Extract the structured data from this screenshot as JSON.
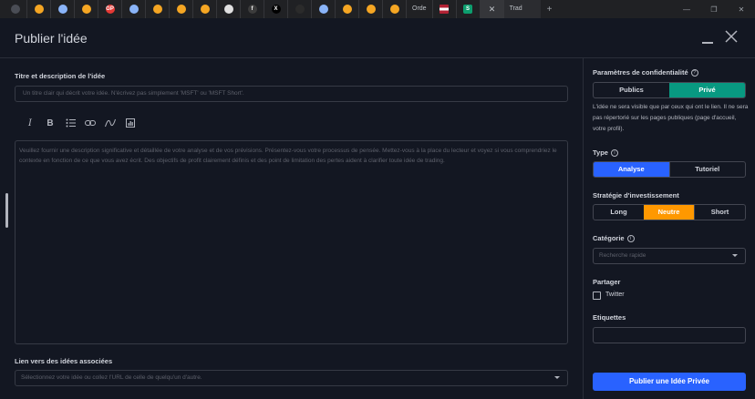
{
  "browser": {
    "tabs": [
      {
        "icon": "document-favicon-icon",
        "color": "#4a4d55",
        "glyph": ""
      },
      {
        "icon": "orange-favicon-icon",
        "color": "#f5a623",
        "glyph": ""
      },
      {
        "icon": "globe-favicon-icon",
        "color": "#8ab4f8",
        "glyph": ""
      },
      {
        "icon": "orange-favicon-icon",
        "color": "#f5a623",
        "glyph": ""
      },
      {
        "icon": "red-favicon-icon",
        "color": "#e53935",
        "glyph": "GP"
      },
      {
        "icon": "globe-favicon-icon",
        "color": "#8ab4f8",
        "glyph": ""
      },
      {
        "icon": "orange-favicon-icon",
        "color": "#f5a623",
        "glyph": ""
      },
      {
        "icon": "orange-favicon-icon",
        "color": "#f5a623",
        "glyph": ""
      },
      {
        "icon": "orange-favicon-icon",
        "color": "#f5a623",
        "glyph": ""
      },
      {
        "icon": "square-favicon-icon",
        "color": "#e0e0e0",
        "glyph": ""
      },
      {
        "icon": "dark-favicon-icon",
        "color": "#3c3c3c",
        "glyph": "f"
      },
      {
        "icon": "x-favicon-icon",
        "color": "#000000",
        "glyph": "X"
      },
      {
        "icon": "dark-favicon-icon",
        "color": "#2b2b2b",
        "glyph": ""
      },
      {
        "icon": "globe-favicon-icon",
        "color": "#8ab4f8",
        "glyph": ""
      },
      {
        "icon": "orange-favicon-icon",
        "color": "#f5a623",
        "glyph": ""
      },
      {
        "icon": "orange-favicon-icon",
        "color": "#f5a623",
        "glyph": ""
      },
      {
        "icon": "orange-favicon-icon",
        "color": "#f5a623",
        "glyph": ""
      }
    ],
    "text_tab": "Orde",
    "flag_icon": "us-flag-favicon-icon",
    "green_tab_glyph": "S",
    "active_tab_title": "Trad"
  },
  "dialog": {
    "title": "Publier l'idée"
  },
  "left": {
    "title_label": "Titre et description de l'idée",
    "title_placeholder": "Un titre clair qui décrit votre idée. N'écrivez pas simplement 'MSFT' ou 'MSFT Short'.",
    "toolbar": [
      "italic-icon",
      "bold-icon",
      "list-icon",
      "link-icon",
      "chart-icon",
      "image-icon"
    ],
    "description_placeholder": "Veuillez fournir une description significative et détaillée de votre analyse et de vos prévisions. Présentez-vous votre processus de pensée. Mettez-vous à la place du lecteur et voyez si vous comprendriez le contexte en fonction de ce que vous avez écrit. Des objectifs de profit clairement définis et des point de limitation des pertes aident à clarifier toute idée de trading.",
    "link_label": "Lien vers des idées associées",
    "link_placeholder": "Sélectionnez votre idée ou collez l'URL de celle de quelqu'un d'autre."
  },
  "right": {
    "privacy_label": "Paramètres de confidentialité",
    "privacy_options": [
      "Publics",
      "Privé"
    ],
    "privacy_selected": "Privé",
    "privacy_help": "L'idée ne sera visible que par ceux qui ont le lien. Il ne sera pas répertorié sur les pages publiques (page d'accueil, votre profil).",
    "type_label": "Type",
    "type_options": [
      "Analyse",
      "Tutoriel"
    ],
    "type_selected": "Analyse",
    "strategy_label": "Stratégie d'investissement",
    "strategy_options": [
      "Long",
      "Neutre",
      "Short"
    ],
    "strategy_selected": "Neutre",
    "category_label": "Catégorie",
    "category_placeholder": "Recherche rapide",
    "share_label": "Partager",
    "twitter_label": "Twitter",
    "twitter_checked": false,
    "tags_label": "Etiquettes",
    "publish_button": "Publier une Idée Privée"
  },
  "colors": {
    "accent_blue": "#2962ff",
    "accent_teal": "#089981",
    "accent_orange": "#ff9800"
  }
}
